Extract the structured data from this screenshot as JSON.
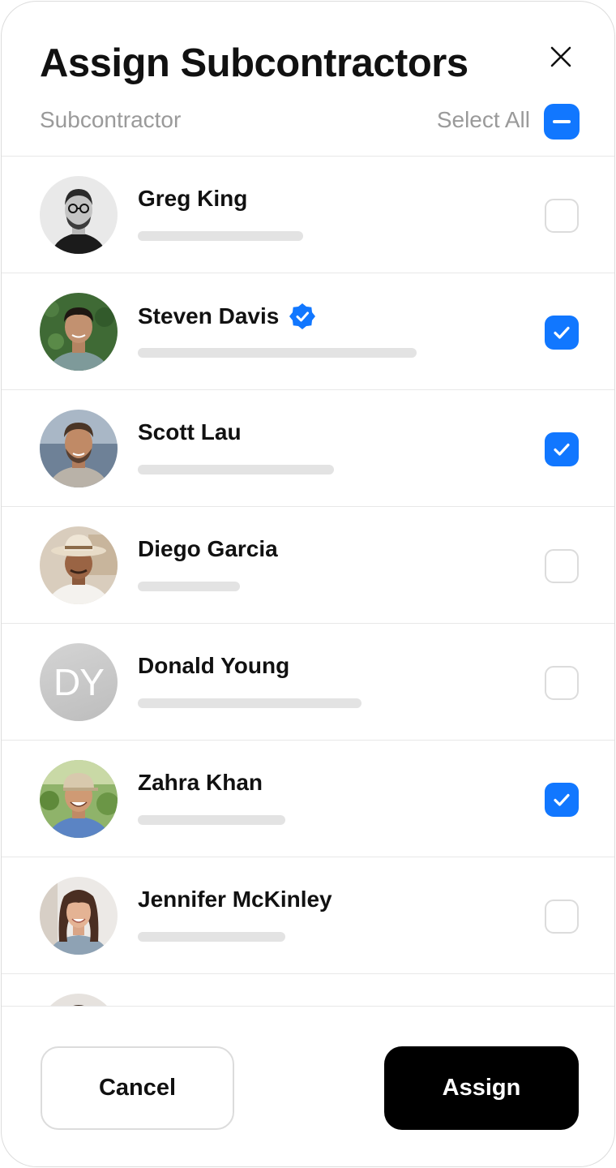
{
  "modal": {
    "title": "Assign Subcontractors",
    "column_label": "Subcontractor",
    "select_all_label": "Select All",
    "select_all_state": "indeterminate"
  },
  "colors": {
    "accent": "#1177ff",
    "text": "#111111",
    "muted": "#9a9a9a",
    "skeleton": "#e3e3e3",
    "divider": "#e8e8e8",
    "primary_button": "#000000"
  },
  "subcontractors": [
    {
      "name": "Greg King",
      "verified": false,
      "checked": false,
      "avatar": "photo-man-glasses-bw"
    },
    {
      "name": "Steven Davis",
      "verified": true,
      "checked": true,
      "avatar": "photo-man-hedge"
    },
    {
      "name": "Scott Lau",
      "verified": false,
      "checked": true,
      "avatar": "photo-man-beard-sea"
    },
    {
      "name": "Diego Garcia",
      "verified": false,
      "checked": false,
      "avatar": "photo-man-straw-hat"
    },
    {
      "name": "Donald Young",
      "verified": false,
      "checked": false,
      "avatar": "initials",
      "initials": "DY"
    },
    {
      "name": "Zahra Khan",
      "verified": false,
      "checked": true,
      "avatar": "photo-man-cap-vineyard"
    },
    {
      "name": "Jennifer McKinley",
      "verified": false,
      "checked": false,
      "avatar": "photo-woman-bangs"
    },
    {
      "name": "",
      "verified": false,
      "checked": false,
      "avatar": "photo-partial"
    }
  ],
  "footer": {
    "cancel_label": "Cancel",
    "assign_label": "Assign"
  }
}
